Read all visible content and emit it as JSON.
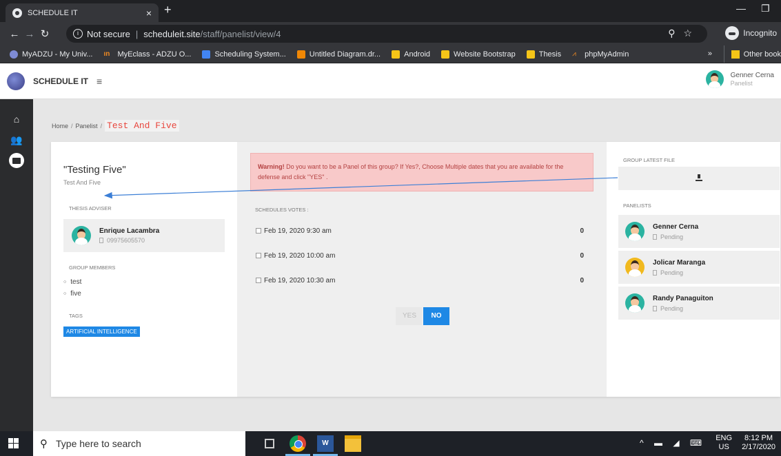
{
  "browser": {
    "tab_title": "SCHEDULE IT",
    "tab_close": "×",
    "new_tab": "+",
    "url_security": "Not secure",
    "url_host": "scheduleit.site",
    "url_path": "/staff/panelist/view/4",
    "incognito_label": "Incognito",
    "bookmarks": [
      "MyADZU - My Univ...",
      "MyEclass - ADZU O...",
      "Scheduling System...",
      "Untitled Diagram.dr...",
      "Android",
      "Website Bootstrap",
      "Thesis",
      "phpMyAdmin"
    ],
    "bookmarks_more": "»",
    "other_bookmarks": "Other book"
  },
  "app": {
    "brand": "SCHEDULE IT",
    "menu_icon": "≡",
    "user_name": "Genner Cerna",
    "user_role": "Panelist"
  },
  "breadcrumb": {
    "home": "Home",
    "sep": "/",
    "panelist": "Panelist",
    "current": "Test And Five"
  },
  "group": {
    "name": "\"Testing Five\"",
    "subtitle": "Test And Five",
    "adviser_label": "THESIS ADVISER",
    "adviser_name": "Enrique Lacambra",
    "adviser_phone": "09975605570",
    "members_label": "GROUP MEMBERS",
    "members": [
      "test",
      "five"
    ],
    "tags_label": "TAGS",
    "tag": "ARTIFICIAL INTELLIGENCE"
  },
  "schedule": {
    "warning_bold": "Warning!",
    "warning_text": " Do you want to be a Panel of this group? If Yes?, Choose Multiple dates that you are available for the defense and click \"YES\" .",
    "votes_label": "SCHEDULES VOTES :",
    "slots": [
      {
        "date": "Feb 19, 2020 9:30 am",
        "votes": "0"
      },
      {
        "date": "Feb 19, 2020 10:00 am",
        "votes": "0"
      },
      {
        "date": "Feb 19, 2020 10:30 am",
        "votes": "0"
      }
    ],
    "yes_label": "YES",
    "no_label": "NO"
  },
  "right": {
    "latest_file_label": "GROUP LATEST FILE",
    "panelists_label": "PANELISTS",
    "panelists": [
      {
        "name": "Genner Cerna",
        "status": "Pending"
      },
      {
        "name": "Jolicar Maranga",
        "status": "Pending"
      },
      {
        "name": "Randy Panaguiton",
        "status": "Pending"
      }
    ]
  },
  "taskbar": {
    "search_placeholder": "Type here to search",
    "lang_top": "ENG",
    "lang_bottom": "US",
    "time": "8:12 PM",
    "date": "2/17/2020"
  },
  "colors": {
    "accent": "#1e88e5",
    "warning_bg": "#f8c9c9",
    "warning_text": "#b34040",
    "breadcrumb_active": "#e8453c",
    "arrow": "#3c7fd6"
  }
}
